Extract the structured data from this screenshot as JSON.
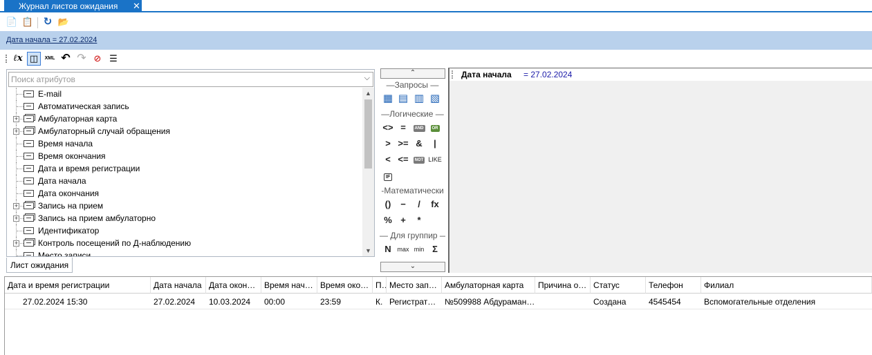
{
  "tab": {
    "title": "Журнал листов ожидания",
    "close": "✕"
  },
  "toolbar": {
    "icons": [
      {
        "name": "new-document-icon",
        "glyph": "📄"
      },
      {
        "name": "copy-document-icon",
        "glyph": "📋"
      },
      {
        "name": "refresh-icon",
        "glyph": "↻"
      },
      {
        "name": "open-folder-icon",
        "glyph": "📂"
      }
    ]
  },
  "filter": {
    "summary": "Дата начала = 27.02.2024"
  },
  "editor_toolbar": {
    "icons": [
      {
        "name": "formula-icon",
        "glyph": "ℓx"
      },
      {
        "name": "filter-design-icon",
        "glyph": "◫"
      },
      {
        "name": "xml-icon",
        "glyph": "XML"
      },
      {
        "name": "undo-icon",
        "glyph": "↶"
      },
      {
        "name": "redo-icon",
        "glyph": "↷"
      },
      {
        "name": "clear-filter-icon",
        "glyph": "⊘"
      },
      {
        "name": "list-icon",
        "glyph": "☰"
      }
    ]
  },
  "attributes": {
    "search_placeholder": "Поиск атрибутов",
    "items": [
      {
        "label": "E-mail",
        "expandable": false
      },
      {
        "label": "Автоматическая запись",
        "expandable": false
      },
      {
        "label": "Амбулаторная карта",
        "expandable": true
      },
      {
        "label": "Амбулаторный случай обращения",
        "expandable": true
      },
      {
        "label": "Время начала",
        "expandable": false
      },
      {
        "label": "Время окончания",
        "expandable": false
      },
      {
        "label": "Дата и время регистрации",
        "expandable": false
      },
      {
        "label": "Дата начала",
        "expandable": false
      },
      {
        "label": "Дата окончания",
        "expandable": false
      },
      {
        "label": "Запись на прием",
        "expandable": true
      },
      {
        "label": "Запись на прием амбулаторно",
        "expandable": true
      },
      {
        "label": "Идентификатор",
        "expandable": false
      },
      {
        "label": "Контроль посещений по Д-наблюдению",
        "expandable": true
      },
      {
        "label": "Место записи",
        "expandable": false
      }
    ],
    "subtab": "Лист ожидания"
  },
  "palette": {
    "scroll_up": "⌃",
    "scroll_down": "⌄",
    "groups": {
      "queries": "—Запросы —",
      "logical": "—Логические —",
      "math": "-Математически",
      "group": "— Для группир —"
    },
    "queries_ops": [
      "▦",
      "▤",
      "▥",
      "▧"
    ],
    "logical_ops": [
      [
        "<>",
        "=",
        "AND",
        "OR"
      ],
      [
        ">",
        ">=",
        "&",
        "|"
      ],
      [
        "<",
        "<=",
        "NOT",
        "LIKE"
      ],
      [
        "IF"
      ]
    ],
    "math_ops": [
      [
        "()",
        "−",
        "/",
        "fx"
      ],
      [
        "%",
        "+",
        "*"
      ]
    ],
    "group_ops": [
      "N",
      "max",
      "min",
      "Σ"
    ]
  },
  "expression": {
    "field": "Дата начала",
    "operator_value": "= 27.02.2024"
  },
  "grid": {
    "columns": [
      "Дата и время регистрации",
      "Дата начала",
      "Дата окон…",
      "Время нач…",
      "Время око…",
      "П…",
      "Место запи…",
      "Амбулаторная карта",
      "Причина о…",
      "Статус",
      "Телефон",
      "Филиал"
    ],
    "rows": [
      [
        "27.02.2024 15:30",
        "27.02.2024",
        "10.03.2024",
        "00:00",
        "23:59",
        "К.",
        "Регистрат…",
        "№509988 Абдураман…",
        "",
        "Создана",
        "4545454",
        "Вспомогательные отделения"
      ]
    ]
  }
}
